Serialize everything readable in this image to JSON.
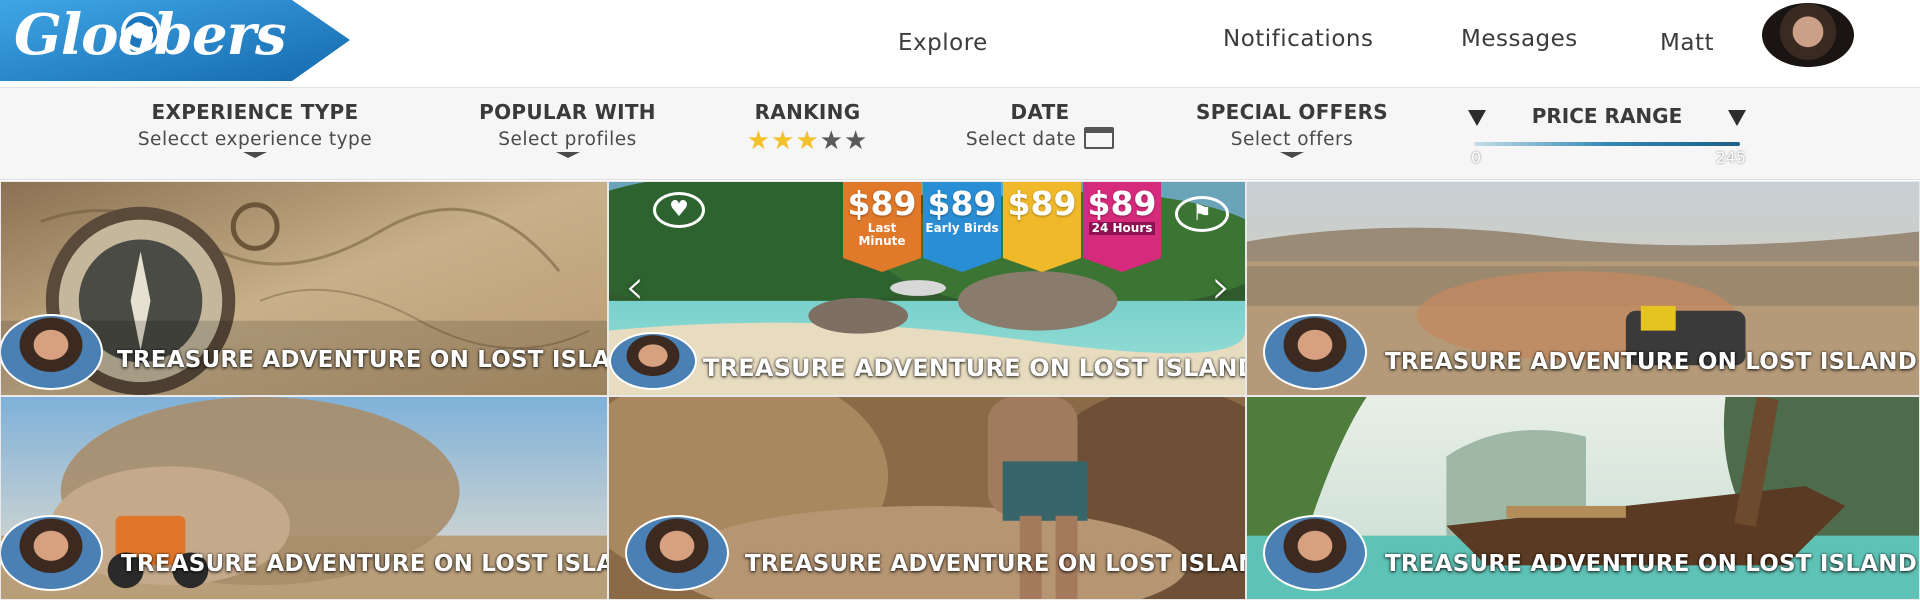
{
  "header": {
    "logo": "Gloobers",
    "nav": {
      "explore": "Explore",
      "notifications": "Notifications",
      "messages": "Messages",
      "user": "Matt"
    }
  },
  "filters": {
    "experience_type": {
      "label": "EXPERIENCE TYPE",
      "value": "Selecct experience type"
    },
    "popular_with": {
      "label": "POPULAR WITH",
      "value": "Select profiles"
    },
    "ranking": {
      "label": "RANKING",
      "stars": 3,
      "max_stars": 5,
      "stars_on": "★★★",
      "stars_off": "★★"
    },
    "date": {
      "label": "DATE",
      "value": "Select date"
    },
    "special_offers": {
      "label": "SPECIAL OFFERS",
      "value": "Select offers"
    },
    "price_range": {
      "label": "PRICE RANGE",
      "min": "0",
      "max": "245"
    }
  },
  "featured": {
    "offers": [
      {
        "price": "$89",
        "label": "Last Minute",
        "color": "#e0792a"
      },
      {
        "price": "$89",
        "label": "Early Birds",
        "color": "#2a8ed4"
      },
      {
        "price": "$89",
        "label": "",
        "color": "#efb92a"
      },
      {
        "price": "$89",
        "label": "24 Hours",
        "color": "#d62a7c"
      }
    ]
  },
  "cards": [
    {
      "title": "TREASURE ADVENTURE ON LOST ISLAND",
      "theme": "map-compass"
    },
    {
      "title": "TREASURE ADVENTURE ON LOST ISLAND",
      "theme": "tropical-beach"
    },
    {
      "title": "TREASURE ADVENTURE ON LOST ISLAND",
      "theme": "desert-rally"
    },
    {
      "title": "TREASURE ADVENTURE ON LOST ISLAND",
      "theme": "quad-dust"
    },
    {
      "title": "TREASURE ADVENTURE ON LOST ISLAND",
      "theme": "canyon-hiker"
    },
    {
      "title": "TREASURE ADVENTURE ON LOST ISLAND",
      "theme": "longtail-boat"
    }
  ],
  "colors": {
    "brand_blue": "#1f7fc2",
    "star_on": "#f3c12b",
    "star_off": "#5a5a5a",
    "price_bar": "#2d7ba8"
  },
  "icons": [
    "heart-icon",
    "flag-icon",
    "calendar-icon",
    "chevron-left-icon",
    "chevron-right-icon",
    "chevron-down-icon"
  ]
}
